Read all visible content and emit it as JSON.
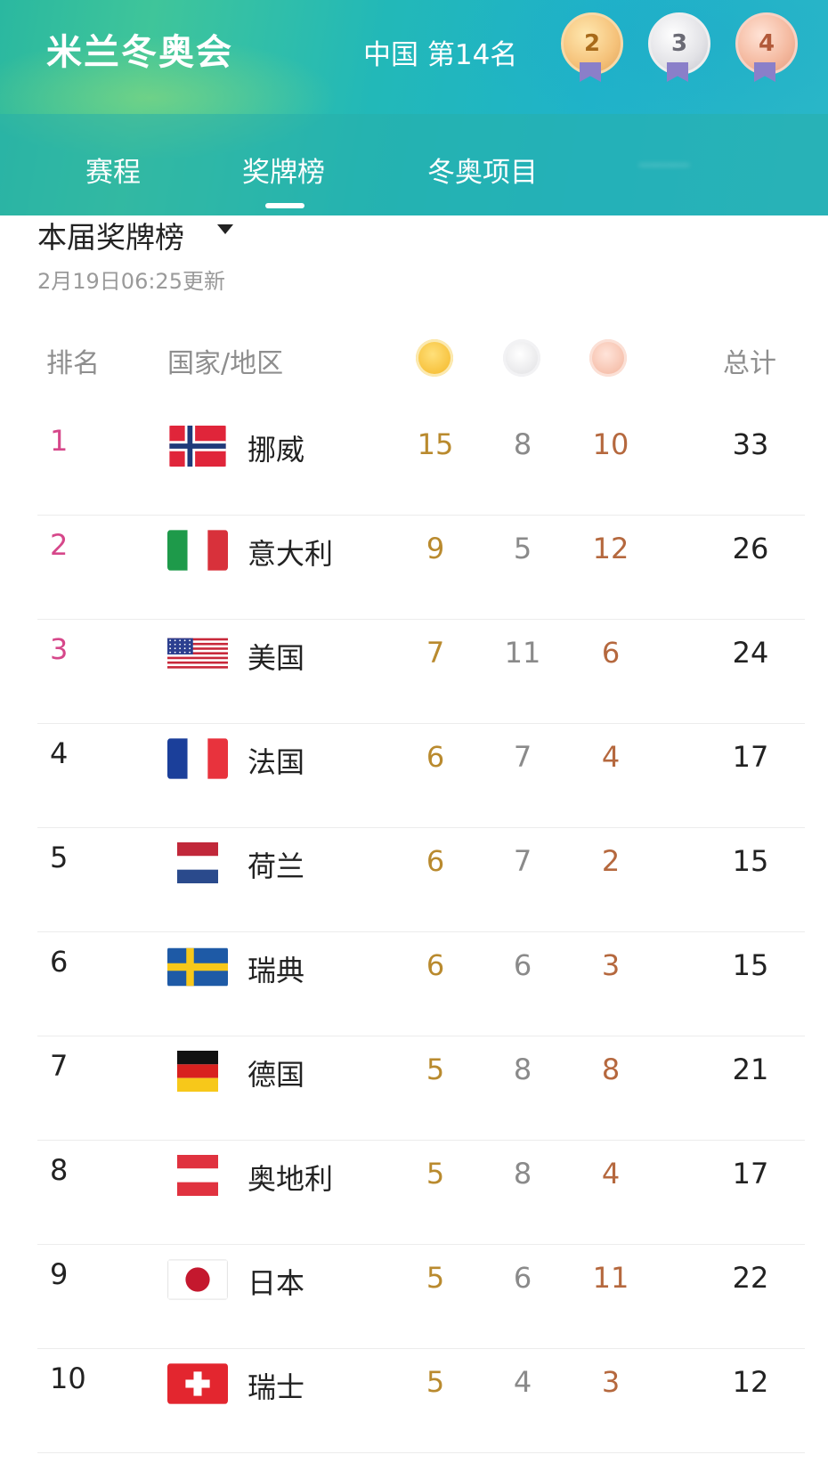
{
  "header": {
    "title": "米兰冬奥会",
    "country_rank": "中国  第14名",
    "medals": {
      "gold": "2",
      "silver": "3",
      "bronze": "4"
    }
  },
  "tabs": [
    "赛程",
    "奖牌榜",
    "冬奥项目"
  ],
  "active_tab": "奖牌榜",
  "board": {
    "title": "本届奖牌榜",
    "update_time": "2月19日06:25更新"
  },
  "table": {
    "headers": {
      "rank": "排名",
      "country": "国家/地区",
      "total": "总计"
    },
    "rows": [
      {
        "rank": "1",
        "country": "挪威",
        "flag": "norway-flag",
        "gold": "15",
        "silver": "8",
        "bronze": "10",
        "total": "33"
      },
      {
        "rank": "2",
        "country": "意大利",
        "flag": "italy-flag",
        "gold": "9",
        "silver": "5",
        "bronze": "12",
        "total": "26"
      },
      {
        "rank": "3",
        "country": "美国",
        "flag": "usa-flag",
        "gold": "7",
        "silver": "11",
        "bronze": "6",
        "total": "24"
      },
      {
        "rank": "4",
        "country": "法国",
        "flag": "france-flag",
        "gold": "6",
        "silver": "7",
        "bronze": "4",
        "total": "17"
      },
      {
        "rank": "5",
        "country": "荷兰",
        "flag": "netherlands-flag",
        "gold": "6",
        "silver": "7",
        "bronze": "2",
        "total": "15"
      },
      {
        "rank": "6",
        "country": "瑞典",
        "flag": "sweden-flag",
        "gold": "6",
        "silver": "6",
        "bronze": "3",
        "total": "15"
      },
      {
        "rank": "7",
        "country": "德国",
        "flag": "germany-flag",
        "gold": "5",
        "silver": "8",
        "bronze": "8",
        "total": "21"
      },
      {
        "rank": "8",
        "country": "奥地利",
        "flag": "austria-flag",
        "gold": "5",
        "silver": "8",
        "bronze": "4",
        "total": "17"
      },
      {
        "rank": "9",
        "country": "日本",
        "flag": "japan-flag",
        "gold": "5",
        "silver": "6",
        "bronze": "11",
        "total": "22"
      },
      {
        "rank": "10",
        "country": "瑞士",
        "flag": "switzerland-flag",
        "gold": "5",
        "silver": "4",
        "bronze": "3",
        "total": "12"
      }
    ]
  },
  "colors": {
    "header_teal": "#22b8b8",
    "top_rank_pink": "#d6478a",
    "gold_text": "#b98a2e",
    "silver_text": "#8a8a8a",
    "bronze_text": "#b5683e"
  }
}
